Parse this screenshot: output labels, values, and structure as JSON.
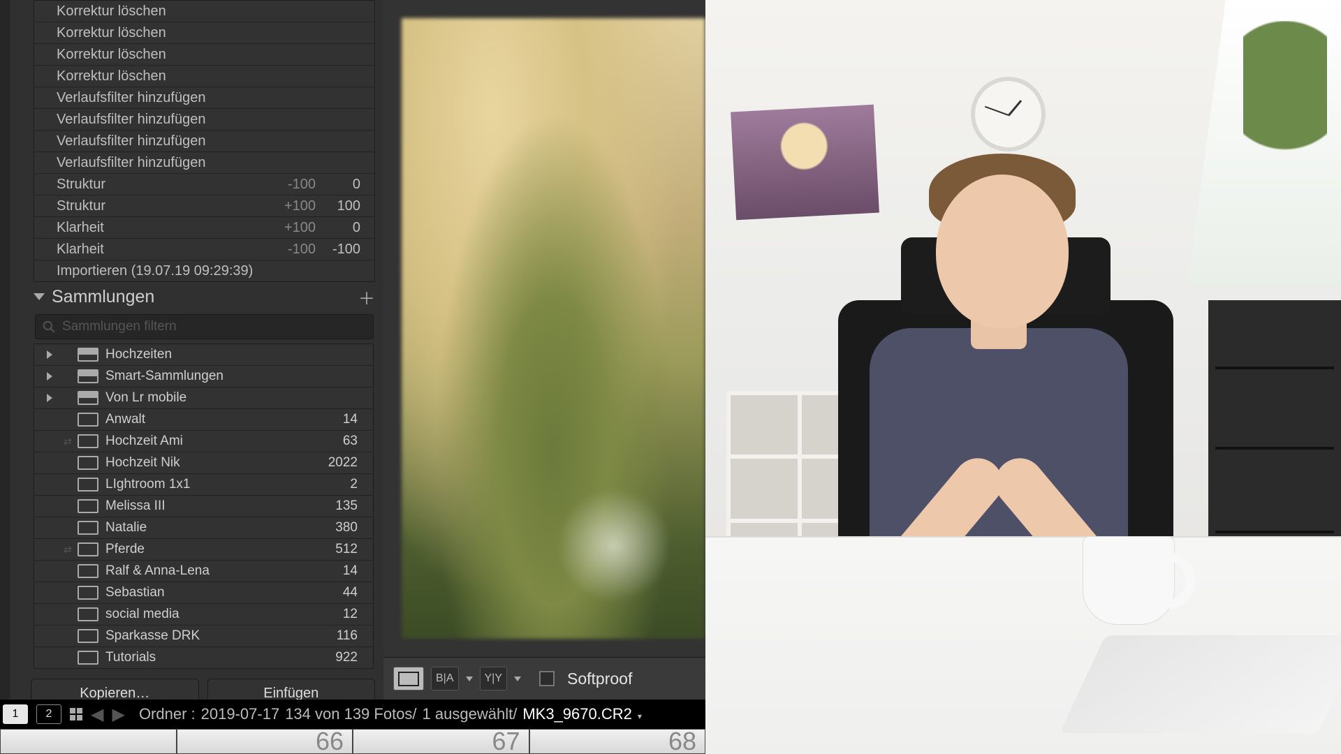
{
  "history": [
    {
      "label": "Korrektur löschen",
      "v1": "",
      "v2": ""
    },
    {
      "label": "Korrektur löschen",
      "v1": "",
      "v2": ""
    },
    {
      "label": "Korrektur löschen",
      "v1": "",
      "v2": ""
    },
    {
      "label": "Korrektur löschen",
      "v1": "",
      "v2": ""
    },
    {
      "label": "Verlaufsfilter hinzufügen",
      "v1": "",
      "v2": ""
    },
    {
      "label": "Verlaufsfilter hinzufügen",
      "v1": "",
      "v2": ""
    },
    {
      "label": "Verlaufsfilter hinzufügen",
      "v1": "",
      "v2": ""
    },
    {
      "label": "Verlaufsfilter hinzufügen",
      "v1": "",
      "v2": ""
    },
    {
      "label": "Struktur",
      "v1": "-100",
      "v2": "0"
    },
    {
      "label": "Struktur",
      "v1": "+100",
      "v2": "100"
    },
    {
      "label": "Klarheit",
      "v1": "+100",
      "v2": "0"
    },
    {
      "label": "Klarheit",
      "v1": "-100",
      "v2": "-100"
    },
    {
      "label": "Importieren (19.07.19 09:29:39)",
      "v1": "",
      "v2": ""
    }
  ],
  "collectionsHeader": {
    "title": "Sammlungen"
  },
  "filter": {
    "placeholder": "Sammlungen filtern"
  },
  "collections": [
    {
      "type": "set",
      "name": "Hochzeiten",
      "count": ""
    },
    {
      "type": "set",
      "name": "Smart-Sammlungen",
      "count": ""
    },
    {
      "type": "set",
      "name": "Von Lr mobile",
      "count": ""
    },
    {
      "type": "coll",
      "name": "Anwalt",
      "count": "14"
    },
    {
      "type": "coll",
      "name": "Hochzeit Ami",
      "count": "63",
      "synced": true
    },
    {
      "type": "coll",
      "name": "Hochzeit Nik",
      "count": "2022"
    },
    {
      "type": "coll",
      "name": "LIghtroom 1x1",
      "count": "2"
    },
    {
      "type": "coll",
      "name": "Melissa III",
      "count": "135"
    },
    {
      "type": "coll",
      "name": "Natalie",
      "count": "380"
    },
    {
      "type": "coll",
      "name": "Pferde",
      "count": "512",
      "synced": true
    },
    {
      "type": "coll",
      "name": "Ralf & Anna-Lena",
      "count": "14"
    },
    {
      "type": "coll",
      "name": "Sebastian",
      "count": "44"
    },
    {
      "type": "coll",
      "name": "social media",
      "count": "12"
    },
    {
      "type": "coll",
      "name": "Sparkasse DRK",
      "count": "116"
    },
    {
      "type": "coll",
      "name": "Tutorials",
      "count": "922"
    }
  ],
  "buttons": {
    "copy": "Kopieren…",
    "paste": "Einfügen"
  },
  "toolbar": {
    "viewSingle": "▭",
    "beforeAfterBA": "B|A",
    "beforeAfterYY": "Y|Y",
    "softproof": "Softproof"
  },
  "infobar": {
    "monitor1": "1",
    "monitor2": "2",
    "folderLabel": "Ordner :",
    "folderDate": "2019-07-17",
    "counts": "134 von 139 Fotos/",
    "selected": "1 ausgewählt/",
    "filename": "MK3_9670.CR2"
  },
  "filmstrip": {
    "f1": "66",
    "f2": "67",
    "f3": "68"
  }
}
